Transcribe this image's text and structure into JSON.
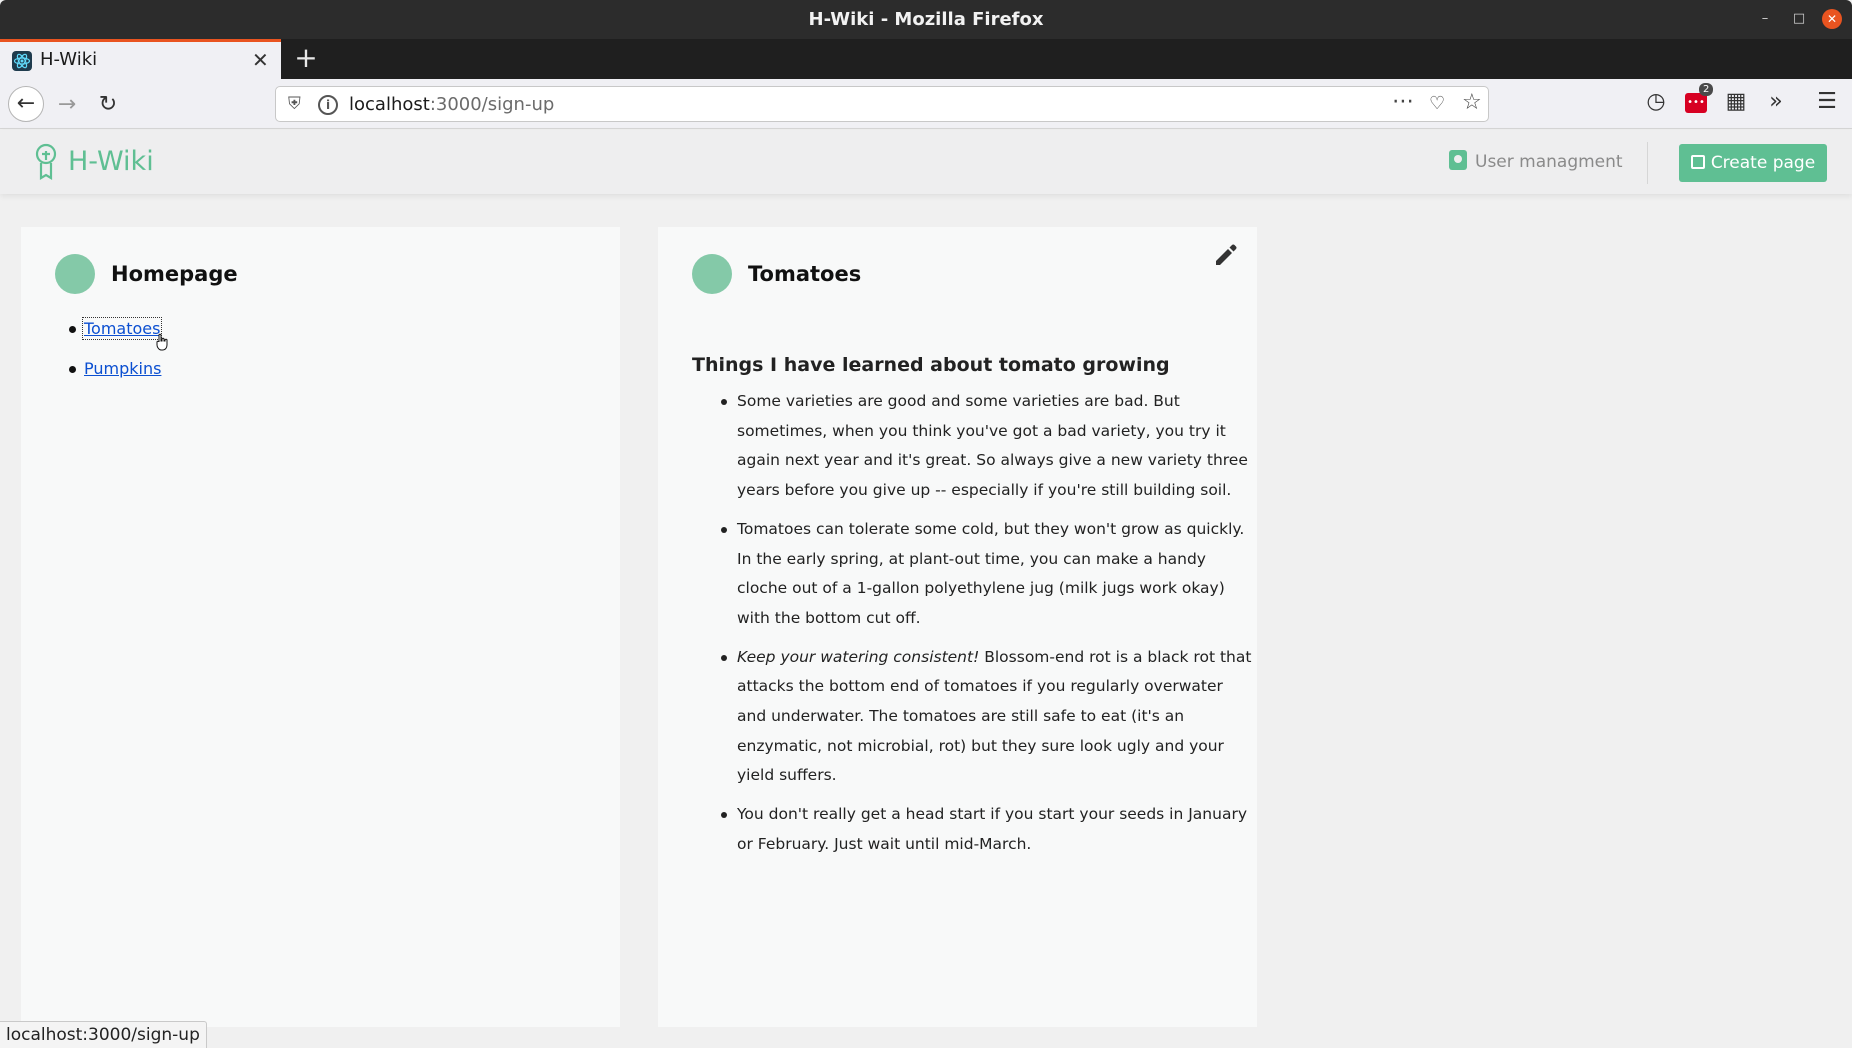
{
  "window": {
    "title": "H-Wiki - Mozilla Firefox"
  },
  "browser": {
    "tab_title": "H-Wiki",
    "url_host": "localhost",
    "url_path": ":3000/sign-up",
    "extension_badge": "2"
  },
  "app": {
    "brand": "H-Wiki",
    "user_management": "User managment",
    "create_page": "Create page"
  },
  "left_card": {
    "title": "Homepage",
    "links": [
      "Tomatoes",
      "Pumpkins"
    ]
  },
  "right_card": {
    "title": "Tomatoes",
    "heading": "Things I have learned about tomato growing",
    "bullets": [
      {
        "em": "",
        "text": "Some varieties are good and some varieties are bad. But sometimes, when you think you've got a bad variety, you try it again next year and it's great. So always give a new variety three years before you give up -- especially if you're still building soil."
      },
      {
        "em": "",
        "text": "Tomatoes can tolerate some cold, but they won't grow as quickly. In the early spring, at plant-out time, you can make a handy cloche out of a 1-gallon polyethylene jug (milk jugs work okay) with the bottom cut off."
      },
      {
        "em": "Keep your watering consistent!",
        "text": " Blossom-end rot is a black rot that attacks the bottom end of tomatoes if you regularly overwater and underwater. The tomatoes are still safe to eat (it's an enzymatic, not microbial, rot) but they sure look ugly and your yield suffers."
      },
      {
        "em": "",
        "text": "You don't really get a head start if you start your seeds in January or February. Just wait until mid-March."
      }
    ]
  },
  "status_bar": {
    "text": "localhost:3000/sign-up"
  },
  "colors": {
    "brand": "#5fbf93",
    "avatar": "#84c9a8",
    "link": "#0b4fd1",
    "tab_accent": "#e95420"
  }
}
